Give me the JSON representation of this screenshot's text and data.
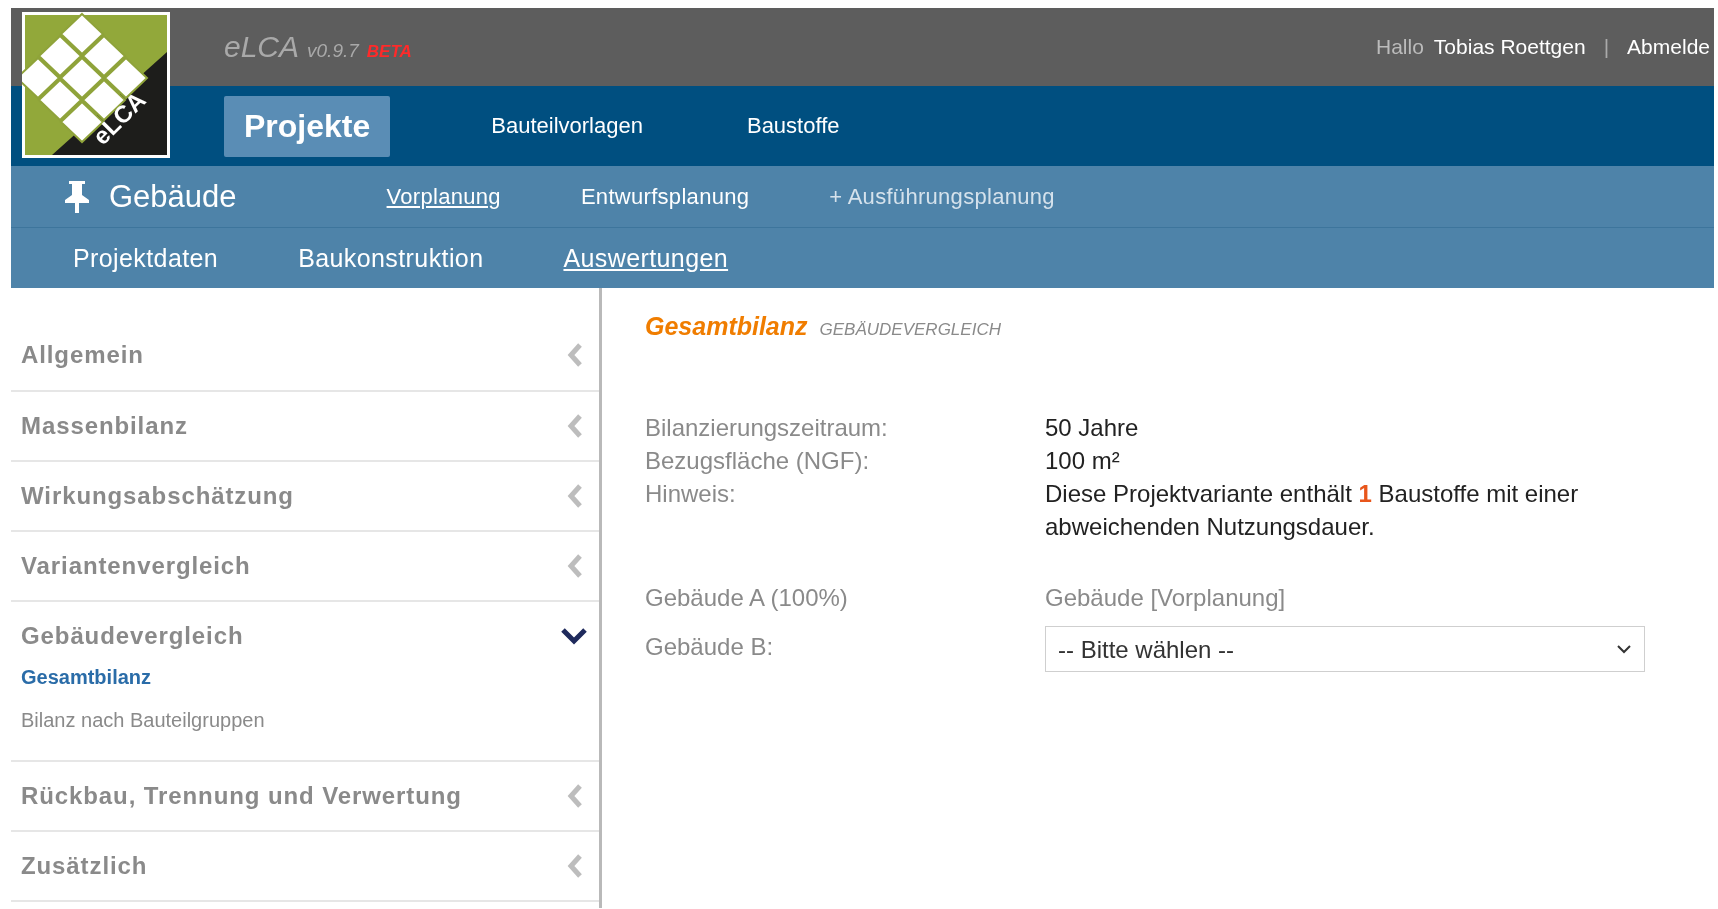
{
  "app": {
    "logo_text": "eLCA",
    "name": "eLCA",
    "version": "v0.9.7",
    "badge": "BETA"
  },
  "user": {
    "greeting": "Hallo",
    "name": "Tobias Roettgen",
    "separator": "|",
    "logout": "Abmelde"
  },
  "main_nav": [
    {
      "label": "Projekte",
      "selected": true
    },
    {
      "label": "Bauteilvorlagen",
      "selected": false
    },
    {
      "label": "Baustoffe",
      "selected": false
    }
  ],
  "project_bar": {
    "title": "Gebäude",
    "phases": [
      {
        "kind": "phase",
        "label": "Vorplanung",
        "selected": true
      },
      {
        "kind": "phase",
        "label": "Entwurfsplanung",
        "selected": false
      },
      {
        "kind": "add",
        "label": "+ Ausführungsplanung",
        "selected": false
      }
    ]
  },
  "section_tabs": [
    {
      "label": "Projektdaten",
      "selected": false
    },
    {
      "label": "Baukonstruktion",
      "selected": false
    },
    {
      "label": "Auswertungen",
      "selected": true
    }
  ],
  "sidebar": {
    "items": [
      {
        "label": "Allgemein",
        "expanded": false
      },
      {
        "label": "Massenbilanz",
        "expanded": false
      },
      {
        "label": "Wirkungsabschätzung",
        "expanded": false
      },
      {
        "label": "Variantenvergleich",
        "expanded": false
      },
      {
        "label": "Gebäudevergleich",
        "expanded": true,
        "children": [
          {
            "label": "Gesamtbilanz",
            "selected": true
          },
          {
            "label": "Bilanz nach Bauteilgruppen",
            "selected": false
          }
        ]
      },
      {
        "label": "Rückbau, Trennung und Verwertung",
        "expanded": false
      },
      {
        "label": "Zusätzlich",
        "expanded": false
      }
    ]
  },
  "content": {
    "title": "Gesamtbilanz",
    "subtitle": "GEBÄUDEVERGLEICH",
    "facts": [
      {
        "label": "Bilanzierungszeitraum:",
        "value": "50 Jahre"
      },
      {
        "label": "Bezugsfläche (NGF):",
        "value": "100 m²"
      },
      {
        "label": "Hinweis:",
        "value": "Diese Projektvariante enthält **1** Baustoffe mit einer abweichenden Nutzungsdauer."
      }
    ],
    "comparison": [
      {
        "kind": "text",
        "label": "Gebäude A (100%)",
        "value": "Gebäude [Vorplanung]"
      },
      {
        "kind": "select",
        "label": "Gebäude B:",
        "value": "-- Bitte wählen --"
      }
    ]
  }
}
